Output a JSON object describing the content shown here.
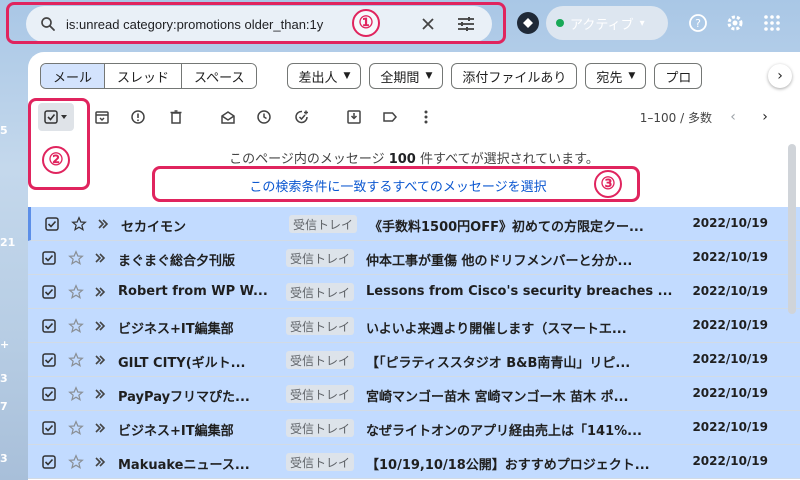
{
  "left_rail": [
    "5",
    "21",
    "+",
    "3",
    "7",
    "3"
  ],
  "search": {
    "query": "is:unread category:promotions older_than:1y",
    "clear_icon": "close-icon",
    "options_icon": "tune-icon"
  },
  "status": {
    "label": "アクティブ"
  },
  "annotations": {
    "one": "①",
    "two": "②",
    "three": "③"
  },
  "tabs": [
    "メール",
    "スレッド",
    "スペース"
  ],
  "filters": [
    "差出人",
    "全期間",
    "添付ファイルあり",
    "宛先",
    "プロ"
  ],
  "pager": {
    "range": "1–100 / 多数"
  },
  "notice": {
    "prefix": "このページ内のメッセージ",
    "count": "100",
    "suffix": "件すべてが選択されています。"
  },
  "select_all": {
    "label": "この検索条件に一致するすべてのメッセージを選択"
  },
  "emails": [
    {
      "sender": "セカイモン",
      "label": "受信トレイ",
      "subject": "《手数料1500円OFF》初めての方限定クー...",
      "date": "2022/10/19"
    },
    {
      "sender": "まぐまぐ総合夕刊版",
      "label": "受信トレイ",
      "subject": "仲本工事が重傷 他のドリフメンバーと分か...",
      "date": "2022/10/19"
    },
    {
      "sender": "Robert from WP W...",
      "label": "受信トレイ",
      "subject": "Lessons from Cisco's security breaches ...",
      "date": "2022/10/19"
    },
    {
      "sender": "ビジネス+IT編集部",
      "label": "受信トレイ",
      "subject": "いよいよ来週より開催します（スマートエ...",
      "date": "2022/10/19"
    },
    {
      "sender": "GILT CITY(ギルト...",
      "label": "受信トレイ",
      "subject": "【「ピラティススタジオ B&B南青山」リピ...",
      "date": "2022/10/19"
    },
    {
      "sender": "PayPayフリマぴた...",
      "label": "受信トレイ",
      "subject": "宮崎マンゴー苗木 宮崎マンゴー木 苗木 ポ...",
      "date": "2022/10/19"
    },
    {
      "sender": "ビジネス+IT編集部",
      "label": "受信トレイ",
      "subject": "なぜライトオンのアプリ経由売上は「141%...",
      "date": "2022/10/19"
    },
    {
      "sender": "Makuakeニュース...",
      "label": "受信トレイ",
      "subject": "【10/19,10/18公開】おすすめプロジェクト...",
      "date": "2022/10/19"
    }
  ],
  "colors": {
    "accent": "#e0245e",
    "selected_row": "#c2dbff",
    "link": "#0b57d0"
  }
}
